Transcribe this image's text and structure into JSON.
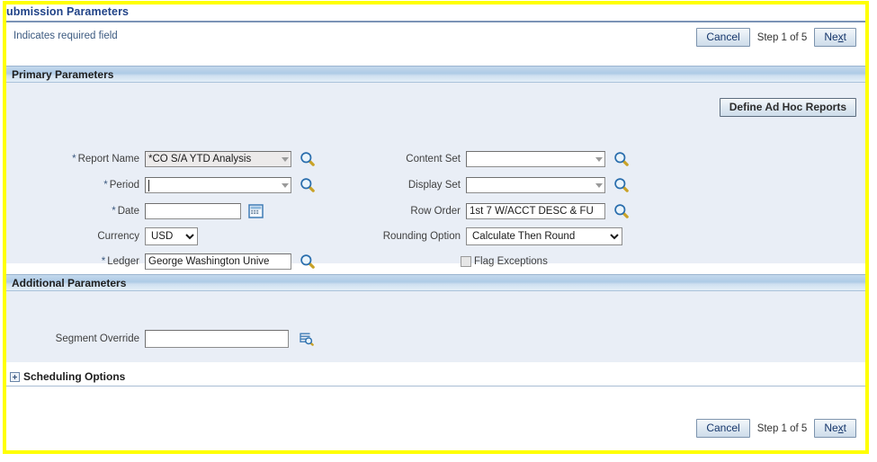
{
  "page": {
    "title": "ubmission Parameters",
    "required_note": "Indicates required field"
  },
  "train": {
    "cancel_label": "Cancel",
    "step_text": "Step 1 of 5",
    "next_label": "Next",
    "next_prefix": "Ne",
    "next_accesskey": "x",
    "next_suffix": "t"
  },
  "primary": {
    "header": "Primary Parameters",
    "define_adhoc_label": "Define Ad Hoc Reports",
    "left_fields": [
      {
        "label": "Report Name",
        "required": true,
        "required_marker": "*",
        "value": "*CO S/A YTD Analysis",
        "placeholder": "",
        "control": "lov",
        "readonly": true,
        "icon": "search-icon"
      },
      {
        "label": "Period",
        "required": true,
        "required_marker": "*",
        "value": "",
        "placeholder": "",
        "control": "lov",
        "readonly": false,
        "focused": true,
        "icon": "search-icon"
      },
      {
        "label": "Date",
        "required": true,
        "required_marker": "*",
        "value": "",
        "placeholder": "",
        "control": "text",
        "icon": "calendar-icon"
      },
      {
        "label": "Currency",
        "required": false,
        "required_marker": "",
        "value": "USD",
        "control": "select",
        "options": [
          "USD"
        ],
        "icon": ""
      },
      {
        "label": "Ledger",
        "required": true,
        "required_marker": "*",
        "value": "George Washington Unive",
        "placeholder": "",
        "control": "text",
        "icon": "search-icon"
      }
    ],
    "right_fields": [
      {
        "label": "Content Set",
        "required": false,
        "value": "",
        "placeholder": "",
        "control": "lov",
        "icon": "search-icon"
      },
      {
        "label": "Display Set",
        "required": false,
        "value": "",
        "placeholder": "",
        "control": "lov",
        "icon": "search-icon"
      },
      {
        "label": "Row Order",
        "required": false,
        "value": "1st 7 W/ACCT DESC & FU",
        "placeholder": "",
        "control": "text",
        "icon": "search-icon"
      },
      {
        "label": "Rounding Option",
        "required": false,
        "value": "Calculate Then Round",
        "control": "select",
        "options": [
          "Calculate Then Round"
        ],
        "icon": ""
      }
    ],
    "flag_exceptions": {
      "label": "Flag Exceptions",
      "checked": false
    }
  },
  "additional": {
    "header": "Additional Parameters",
    "segment_override": {
      "label": "Segment Override",
      "value": "",
      "placeholder": "",
      "icon": "flexfield-search-icon"
    }
  },
  "scheduling": {
    "label": "Scheduling Options",
    "expanded": false,
    "toggle_icon": "plus-box-icon"
  },
  "bottom_train": {
    "cancel_label": "Cancel",
    "step_text": "Step 1 of 5",
    "next_label": "Next",
    "next_prefix": "Ne",
    "next_accesskey": "x",
    "next_suffix": "t"
  },
  "colors": {
    "highlight_frame": "#ffff00",
    "panel_bg": "#e9eef6",
    "section_header_blue": "#aecbe6",
    "title_blue": "#224488",
    "required_star": "#3c5a80"
  }
}
